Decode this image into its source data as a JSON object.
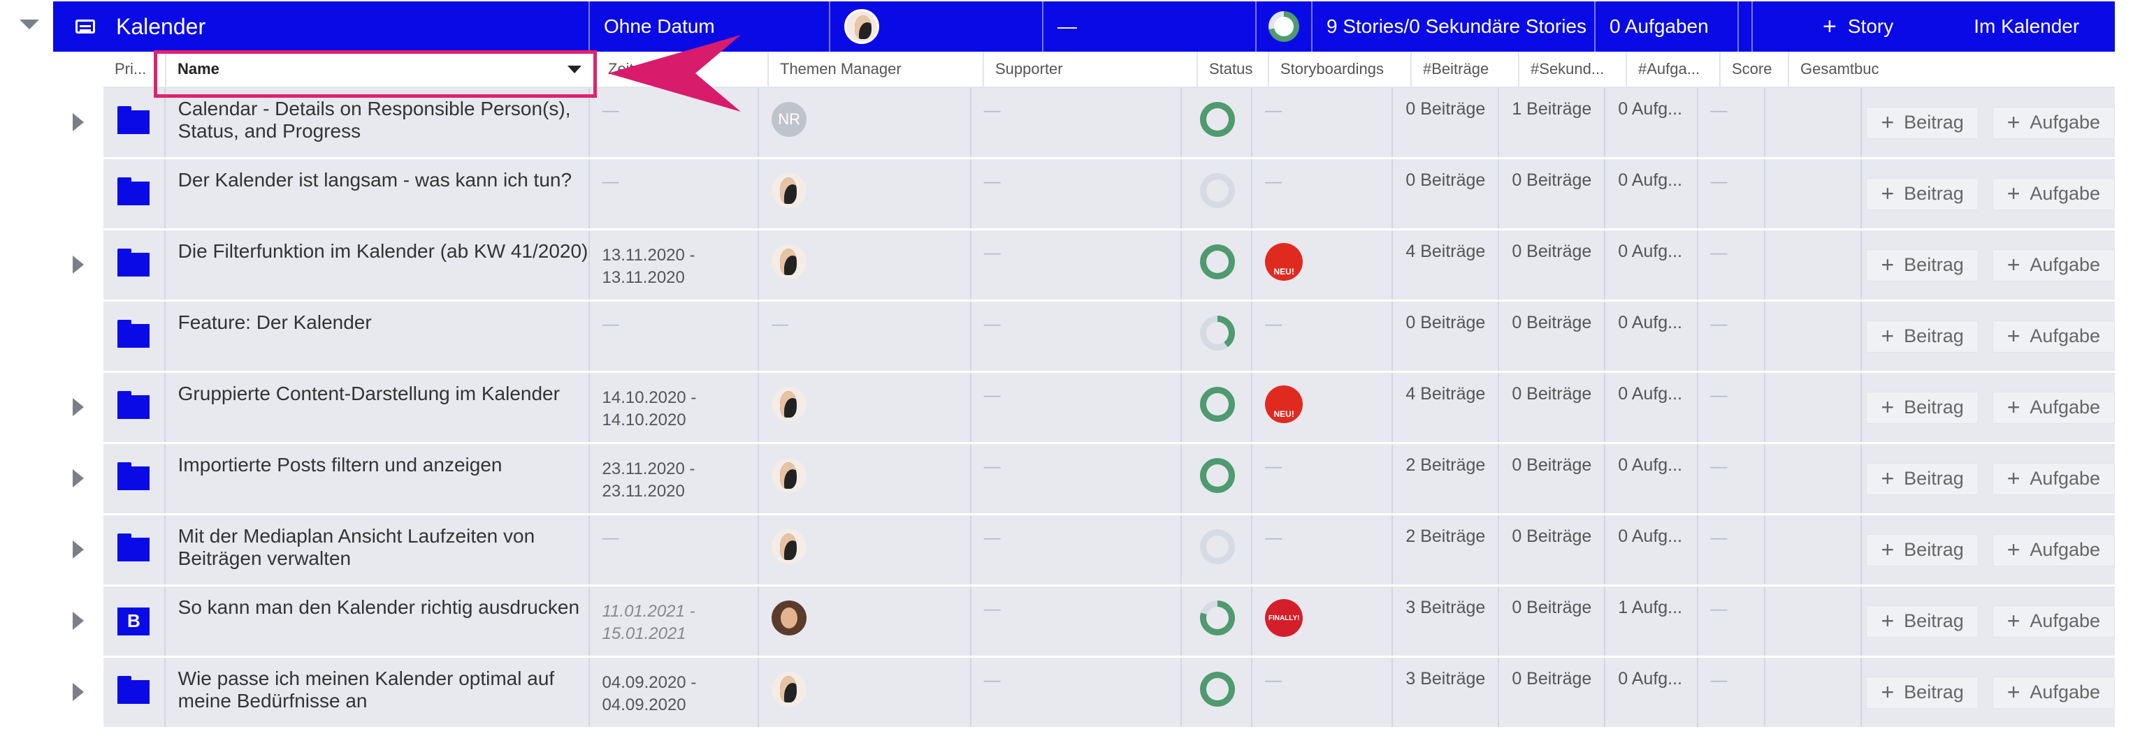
{
  "group": {
    "title": "Kalender",
    "date": "Ohne Datum",
    "dash": "—",
    "stories": "9 Stories/0 Sekundäre Stories",
    "tasks": "0 Aufgaben",
    "story_button": "Story",
    "calendar_button": "Im Kalender"
  },
  "columns": [
    "Pri...",
    "Name",
    "Zeitraum",
    "Themen Manager",
    "Supporter",
    "Status",
    "Storyboardings",
    "#Beiträge",
    "#Sekund...",
    "#Aufga...",
    "Score",
    "Gesamtbuc"
  ],
  "actions": {
    "beitrag": "Beitrag",
    "aufgabe": "Aufgabe",
    "plus": "+"
  },
  "rows": [
    {
      "name": "Calendar - Details on Responsible Person(s), Status, and Progress",
      "dates": "—",
      "manager": "NR",
      "supporter": "—",
      "status_percent": 100,
      "storyboard": "—",
      "beitraege": "0 Beiträge",
      "sekundaer": "1 Beiträge",
      "aufgaben": "0 Aufg...",
      "score": "—"
    },
    {
      "name": "Der Kalender ist langsam - was kann ich tun?",
      "dates": "—",
      "manager": "man",
      "supporter": "—",
      "status_percent": 0,
      "storyboard": "—",
      "beitraege": "0 Beiträge",
      "sekundaer": "0 Beiträge",
      "aufgaben": "0 Aufg...",
      "score": "—"
    },
    {
      "name": "Die Filterfunktion im Kalender (ab KW 41/2020)",
      "dates": "13.11.2020 - 13.11.2020",
      "manager": "man",
      "supporter": "—",
      "status_percent": 100,
      "storyboard": "NEU!",
      "beitraege": "4 Beiträge",
      "sekundaer": "0 Beiträge",
      "aufgaben": "0 Aufg...",
      "score": "—"
    },
    {
      "name": "Feature: Der Kalender",
      "dates": "—",
      "manager": "—",
      "supporter": "—",
      "status_percent": 40,
      "storyboard": "—",
      "beitraege": "0 Beiträge",
      "sekundaer": "0 Beiträge",
      "aufgaben": "0 Aufg...",
      "score": "—"
    },
    {
      "name": "Gruppierte Content-Darstellung im Kalender",
      "dates": "14.10.2020 - 14.10.2020",
      "manager": "man",
      "supporter": "—",
      "status_percent": 100,
      "storyboard": "NEU!",
      "beitraege": "4 Beiträge",
      "sekundaer": "0 Beiträge",
      "aufgaben": "0 Aufg...",
      "score": "—"
    },
    {
      "name": "Importierte Posts filtern und anzeigen",
      "dates": "23.11.2020 - 23.11.2020",
      "manager": "man",
      "supporter": "—",
      "status_percent": 100,
      "storyboard": "—",
      "beitraege": "2 Beiträge",
      "sekundaer": "0 Beiträge",
      "aufgaben": "0 Aufg...",
      "score": "—"
    },
    {
      "name": "Mit der Mediaplan Ansicht Laufzeiten von Beiträgen verwalten",
      "dates": "—",
      "manager": "man",
      "supporter": "—",
      "status_percent": 0,
      "storyboard": "—",
      "beitraege": "2 Beiträge",
      "sekundaer": "0 Beiträge",
      "aufgaben": "0 Aufg...",
      "score": "—"
    },
    {
      "name": "So kann man den Kalender richtig ausdrucken",
      "dates": "11.01.2021 - 15.01.2021",
      "manager": "woman",
      "supporter": "—",
      "status_percent": 80,
      "storyboard": "FINALLY!",
      "beitraege": "3 Beiträge",
      "sekundaer": "0 Beiträge",
      "aufgaben": "1 Aufg...",
      "score": "—"
    },
    {
      "name": "Wie passe ich meinen Kalender optimal auf meine Bedürfnisse an",
      "dates": "04.09.2020 - 04.09.2020",
      "manager": "man",
      "supporter": "—",
      "status_percent": 100,
      "storyboard": "—",
      "beitraege": "3 Beiträge",
      "sekundaer": "0 Beiträge",
      "aufgaben": "0 Aufg...",
      "score": "—"
    }
  ]
}
